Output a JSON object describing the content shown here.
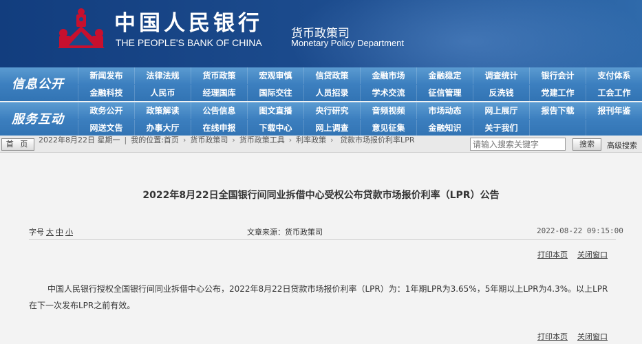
{
  "header": {
    "bank_name_cn": "中国人民银行",
    "bank_name_en": "THE PEOPLE'S BANK OF CHINA",
    "dept_name_cn": "货币政策司",
    "dept_name_en": "Monetary Policy Department",
    "logo_icon": "pboc-emblem-icon",
    "colors": {
      "background": "#1a4888",
      "logo": "#c8102e"
    }
  },
  "nav": {
    "info_label": "信息公开",
    "info_items": [
      "新闻发布",
      "法律法规",
      "货币政策",
      "宏观审慎",
      "信贷政策",
      "金融市场",
      "金融稳定",
      "调查统计",
      "银行会计",
      "支付体系",
      "金融科技",
      "人民币",
      "经理国库",
      "国际交往",
      "人员招录",
      "学术交流",
      "征信管理",
      "反洗钱",
      "党建工作",
      "工会工作"
    ],
    "service_label": "服务互动",
    "service_items": [
      "政务公开",
      "政策解读",
      "公告信息",
      "图文直播",
      "央行研究",
      "音频视频",
      "市场动态",
      "网上展厅",
      "报告下载",
      "报刊年鉴",
      "网送文告",
      "办事大厅",
      "在线申报",
      "下载中心",
      "网上调查",
      "意见征集",
      "金融知识",
      "关于我们",
      "",
      ""
    ]
  },
  "subbar": {
    "home_button": "首 页",
    "date": "2022年8月22日 星期一",
    "location": "我的位置:首页",
    "crumbs": [
      "货币政策司",
      "货币政策工具",
      "利率政策",
      "贷款市场报价利率LPR"
    ],
    "search_placeholder": "请输入搜索关键字",
    "search_button": "搜索",
    "advanced_search": "高级搜索"
  },
  "article": {
    "title": "2022年8月22日全国银行间同业拆借中心受权公布贷款市场报价利率（LPR）公告",
    "font_size_label": "字号",
    "font_sizes": [
      "大",
      "中",
      "小"
    ],
    "source": "文章来源：货币政策司",
    "datetime": "2022-08-22 09:15:00",
    "print_label": "打印本页",
    "close_label": "关闭窗口",
    "body": "中国人民银行授权全国银行间同业拆借中心公布，2022年8月22日贷款市场报价利率（LPR）为：1年期LPR为3.65%，5年期以上LPR为4.3%。以上LPR在下一次发布LPR之前有效。"
  }
}
